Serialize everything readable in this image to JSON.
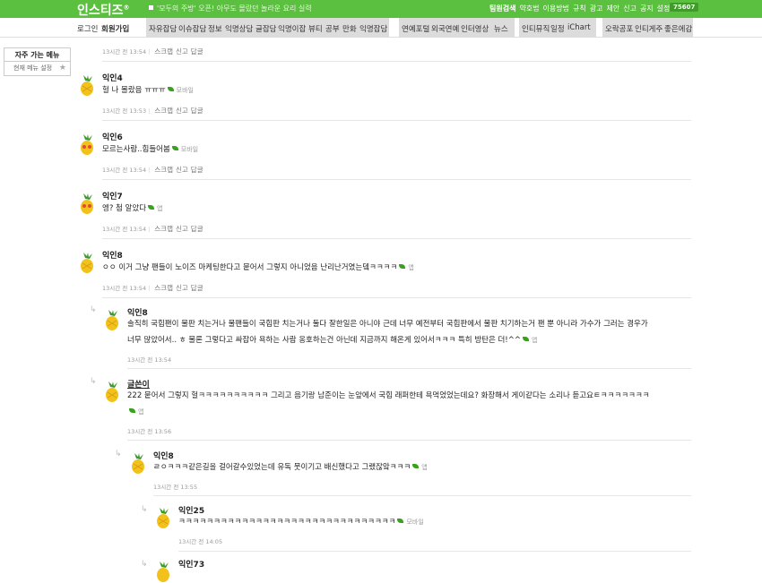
{
  "header": {
    "logo": "인스티즈",
    "logo_mark": "®",
    "tagline": "'모두의 주방' 오픈! 아무도 몰랐던 놀라운 요리 실력",
    "links": [
      "팀원검색",
      "약호법",
      "이용방법",
      "규칙",
      "광고",
      "제안",
      "신고",
      "공지",
      "설정"
    ],
    "counter": "75607"
  },
  "menu": {
    "login": "로그인",
    "signup": "회원가입",
    "group1": [
      "자유잡담",
      "이슈잡담",
      "정보",
      "익명상담",
      "글잡담",
      "익명이잡",
      "뷰티",
      "공부",
      "만화",
      "익명잡담"
    ],
    "group2": [
      "연예포털",
      "외국연예",
      "인터영상",
      "뉴스"
    ],
    "group3": [
      "인티뮤직",
      "일정",
      "iChart"
    ],
    "group4": [
      "오락공포",
      "인티게주",
      "좋은에감"
    ]
  },
  "sidebar": {
    "favorites": "자주 가는 메뉴",
    "current_setting": "현재 메뉴 설정"
  },
  "actions": {
    "scrap": "스크랩",
    "report": "신고",
    "reply": "답글"
  },
  "comments": [
    {
      "author": "",
      "text": "",
      "device": "",
      "time": "13시간 전 13:54"
    },
    {
      "author": "익인4",
      "text": "헐 나 몰랐음 ㅠㅠㅠ",
      "device": "모바일",
      "time": "13시간 전 13:53"
    },
    {
      "author": "익인6",
      "text": "모르는사람..힘들어봄",
      "device": "모바일",
      "time": "13시간 전 13:54"
    },
    {
      "author": "익인7",
      "text": "엥? 첨 알았다",
      "device": "앱",
      "time": "13시간 전 13:54"
    },
    {
      "author": "익인8",
      "text": "ㅇㅇ 이거 그냥 팬들이 노이즈 마케팅한다고 뭍어서 그렇지 아니었음 난리난거였는뎈ㅋㅋㅋㅋ",
      "device": "앱",
      "time": "13시간 전 13:54"
    },
    {
      "author": "익인8",
      "text": "솔직히 국힙팬이 물판 치는거나 물팬들이 국힙판 치는거나 둘다 잘한일은 아니야 근데 너무 예전부터 국힙판에서 물판 치기하는거 팬 뿐 아니라 가수가 그러는 경우가",
      "text2": "너무 많았어서.. ㅎ 물론 그렇다고 싸잡아 욕하는 사람 옹호하는건 아닌데 지금까지 해온게 있어서ㅋㅋㅋ 특히 방탄은 더!^^",
      "device": "앱",
      "time": "13시간 전 13:54"
    },
    {
      "author": "글쓴이",
      "text": "222 뭍어서 그렇지 헐ㅋㅋㅋㅋㅋㅋㅋㅋㅋㅋ 그리고 음기랑 남준이는 눈앞에서 국힙 래퍼한테 욕먹었었는데요? 화장해서 게이같다는 소리나 듣고요ㅌㅋㅋㅋㅋㅋㅋㅋ",
      "device": "앱",
      "time": "13시간 전 13:56"
    },
    {
      "author": "익인8",
      "text": "ㄹㅇㅋㅋㅋ같은길을 걸어갈수있었는데 유독 뭇이기고 배신했다고 그랬잖앜ㅋㅋㅋ",
      "device": "앱",
      "time": "13시간 전 13:55"
    },
    {
      "author": "익인25",
      "text": "ㅋㅋㅋㅋㅋㅋㅋㅋㅋㅋㅋㅋㅋㅋㅋㅋㅋㅋㅋㅋㅋㅋㅋㅋㅋㅋㅋㅋㅋㅋㅋ",
      "device": "모바일",
      "time": "13시간 전 14:05"
    },
    {
      "author": "익인73",
      "text": "",
      "device": "",
      "time": ""
    }
  ]
}
